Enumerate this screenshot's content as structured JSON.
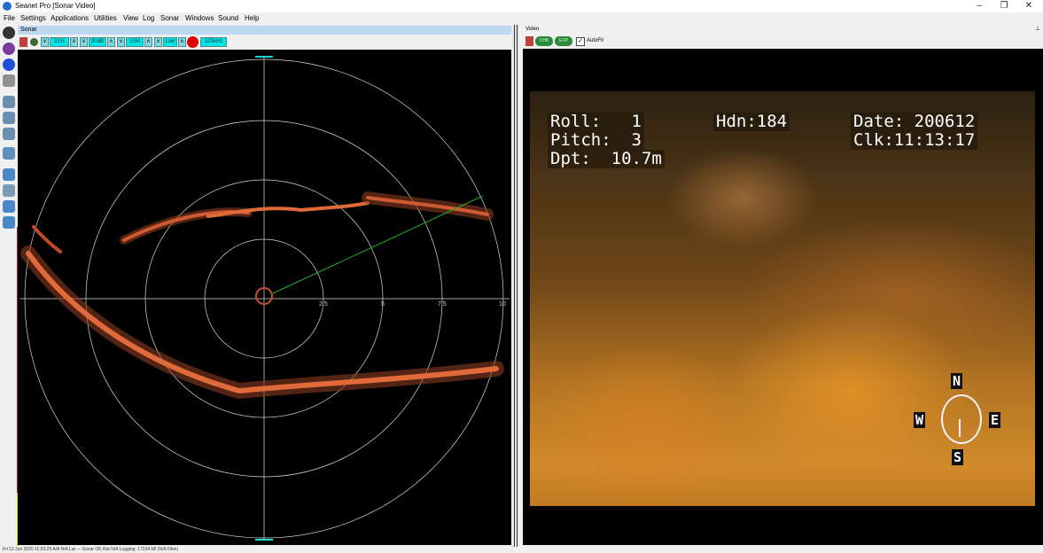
{
  "window": {
    "title": "Seanet Pro [Sonar Video]",
    "minimize": "–",
    "restore": "❐",
    "close": "✕"
  },
  "menu": [
    "File",
    "Settings",
    "Applications",
    "Utilities",
    "View",
    "Log",
    "Sonar",
    "Windows",
    "Sound",
    "Help"
  ],
  "sonar": {
    "panel_title": "Sonar",
    "toolbar": {
      "gain": "31%",
      "contrast": "30dB",
      "range": "10M",
      "resolution": "Low",
      "frequency": "325kHz"
    },
    "range_labels": [
      "2.5",
      "5",
      "7.5",
      "10"
    ]
  },
  "video": {
    "panel_title": "Video",
    "btn_chk": "CHK",
    "btn_exp": "EXP",
    "autofit_label": "AutoFit",
    "overlay": {
      "roll": "Roll:   1",
      "pitch": "Pitch:  3",
      "depth": "Dpt:  10.7m",
      "heading": "Hdn:184",
      "date": "Date: 200612",
      "clock": "Clk:11:13:17"
    },
    "compass": {
      "n": "N",
      "s": "S",
      "e": "E",
      "w": "W"
    }
  },
  "status": {
    "text": "Fri 12 Jun 2020 11:53:25       A/A N/A       Lat ---       Sonar OK       Rat N/A       Logging: 17234 kB (N/A Files)"
  },
  "colors": {
    "sonar_echo": "#e06a3a",
    "scan_line": "#22b022",
    "range_ring": "#d8d8d8",
    "accent": "#00e5e5"
  }
}
